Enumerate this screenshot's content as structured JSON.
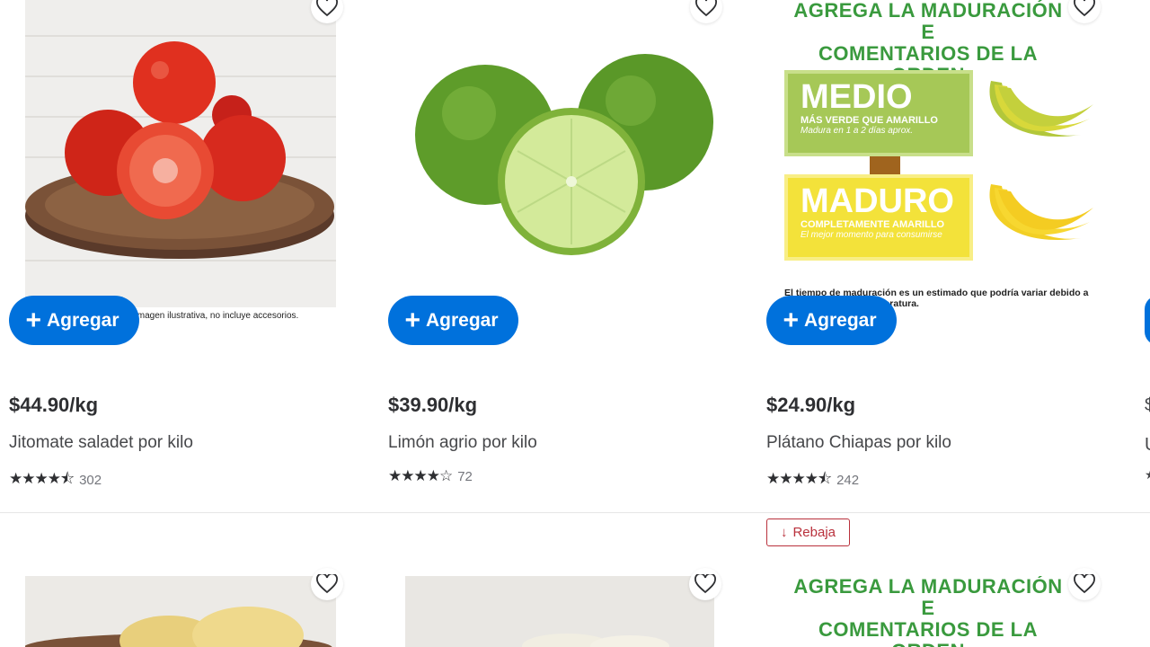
{
  "products": [
    {
      "price": "$44.90/kg",
      "title": "Jitomate saladet por kilo",
      "rating_count": "302",
      "add_label": "Agregar",
      "stars": "★★★★⯪",
      "image_caption": "Imagen ilustrativa, no incluye accesorios."
    },
    {
      "price": "$39.90/kg",
      "title": "Limón agrio por kilo",
      "rating_count": "72",
      "add_label": "Agregar",
      "stars": "★★★★☆"
    },
    {
      "price": "$24.90/kg",
      "title": "Plátano Chiapas por kilo",
      "rating_count": "242",
      "add_label": "Agregar",
      "stars": "★★★★⯪"
    }
  ],
  "banner": {
    "headline_1": "AGREGA LA MADURACIÓN E",
    "headline_2": "COMENTARIOS DE LA ORDEN",
    "medio_title": "MEDIO",
    "medio_sub": "MÁS VERDE QUE AMARILLO",
    "medio_note": "Madura en 1 a 2 días aprox.",
    "maduro_title": "MADURO",
    "maduro_sub": "COMPLETAMENTE AMARILLO",
    "maduro_note": "El mejor momento para consumirse",
    "footnote": "El tiempo de maduración es un estimado que podría variar debido a factores como la temperatura."
  },
  "badge": {
    "label": "Rebaja"
  },
  "colors": {
    "accent": "#0071dc",
    "text": "#2e2f32",
    "banner_green": "#3a9a3e",
    "sale": "#b9313c"
  }
}
